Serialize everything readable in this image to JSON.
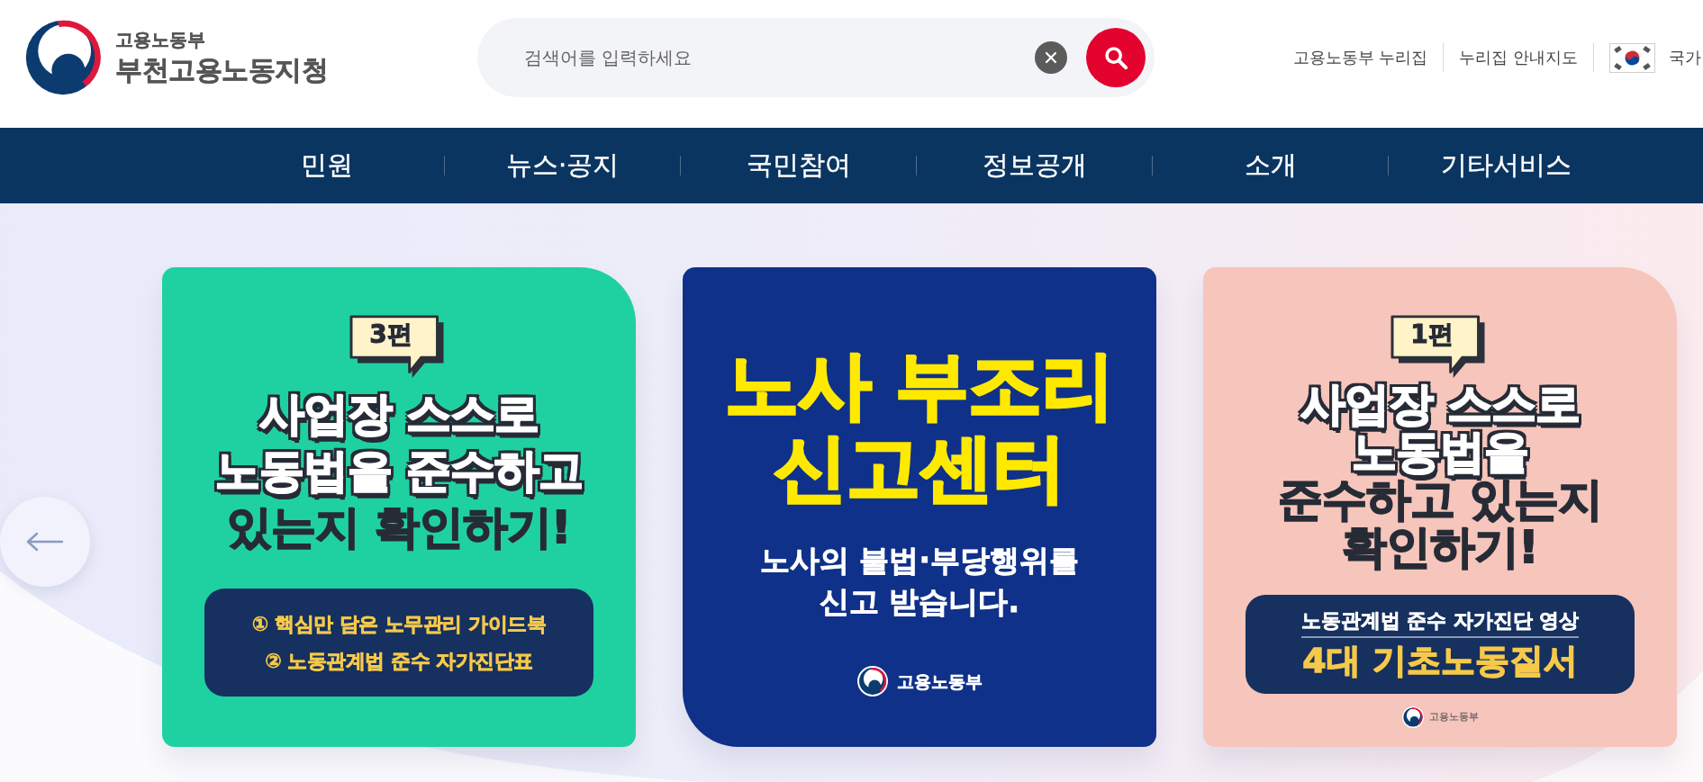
{
  "header": {
    "logo": {
      "ministry": "고용노동부",
      "office": "부천고용노동지청"
    },
    "search": {
      "placeholder": "검색어를 입력하세요"
    },
    "utility_links": [
      {
        "kind": "link",
        "label": "고용노동부 누리집"
      },
      {
        "kind": "link",
        "label": "누리집 안내지도"
      },
      {
        "kind": "flag",
        "label": "국가"
      }
    ]
  },
  "main_menu": [
    "민원",
    "뉴스·공지",
    "국민참여",
    "정보공개",
    "소개",
    "기타서비스"
  ],
  "carousel": {
    "slides": [
      {
        "color": "#1fd1a1",
        "blocks": [
          {
            "kind": "bubble",
            "text": "3편"
          },
          {
            "kind": "headline",
            "lines": [
              {
                "kind": "outlined",
                "text": "사업장 스스로"
              },
              {
                "kind": "outlined",
                "text": "노동법을 준수하고"
              },
              {
                "kind": "plain",
                "text": "있는지 확인하기!"
              }
            ]
          },
          {
            "kind": "infobox",
            "lines": [
              {
                "kind": "item",
                "text": "① 핵심만 담은 노무관리 가이드북"
              },
              {
                "kind": "item",
                "text": "② 노동관계법 준수 자가진단표"
              }
            ]
          }
        ]
      },
      {
        "color": "#0f3189",
        "blocks": [
          {
            "kind": "title",
            "lines": [
              "노사 부조리",
              "신고센터"
            ]
          },
          {
            "kind": "message",
            "lines": [
              "노사의 불법·부당행위를",
              "신고 받습니다."
            ]
          },
          {
            "kind": "signature",
            "text": "고용노동부"
          }
        ]
      },
      {
        "color": "#f6c5bb",
        "blocks": [
          {
            "kind": "bubble",
            "text": "1편"
          },
          {
            "kind": "headline",
            "lines": [
              {
                "kind": "outlined",
                "text": "사업장 스스로"
              },
              {
                "kind": "outlined",
                "text": "노동법을"
              },
              {
                "kind": "plain",
                "text": "준수하고 있는지"
              },
              {
                "kind": "plain",
                "text": "확인하기!"
              }
            ]
          },
          {
            "kind": "infobox",
            "lines": [
              {
                "kind": "caption",
                "text": "노동관계법 준수 자가진단 영상"
              },
              {
                "kind": "highlight",
                "text": "4대 기초노동질서"
              }
            ]
          },
          {
            "kind": "credit",
            "text": "고용노동부"
          }
        ]
      }
    ]
  }
}
